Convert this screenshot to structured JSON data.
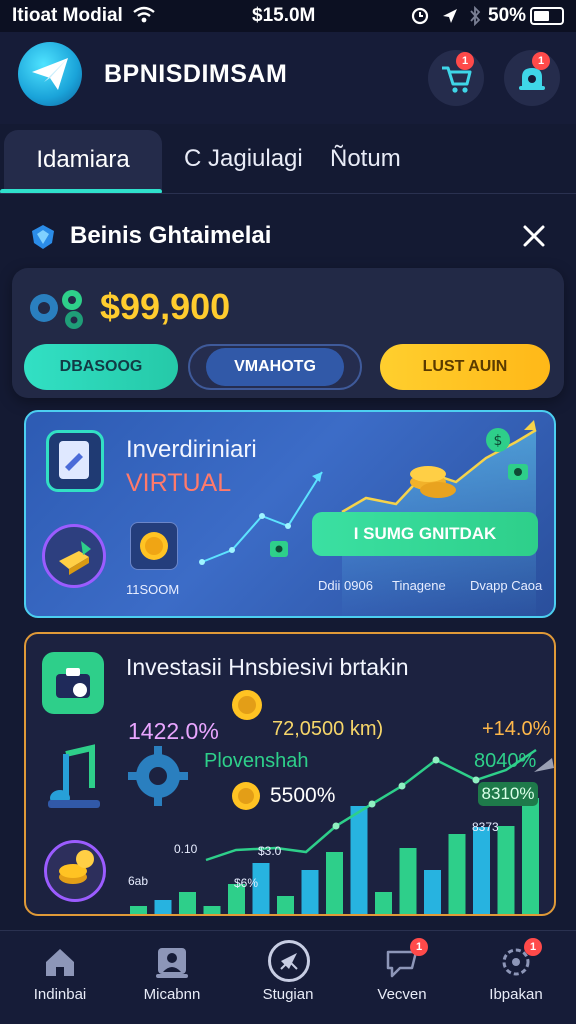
{
  "status_bar": {
    "carrier": "Itioat Modial",
    "center": "$15.0M",
    "battery": "50%"
  },
  "header": {
    "app_title": "BPNISDIMSAM",
    "cart_badge": "1",
    "profile_badge": "1"
  },
  "tabs": [
    {
      "label": "Idamiara",
      "active": true
    },
    {
      "label": "C Jagiulagi",
      "active": false
    },
    {
      "label": "Ñotum",
      "active": false
    }
  ],
  "section": {
    "title": "Beinis Ghtaimelai"
  },
  "balance_card": {
    "amount": "$99,900",
    "buttons": [
      {
        "label": "DBASOOG",
        "color": "#2fd9b8"
      },
      {
        "label": "VMAHOTG",
        "color": "#3159a8"
      },
      {
        "label": "LUST AUIN",
        "color": "#ffc323"
      }
    ]
  },
  "promo_card": {
    "title": "Inverdiriniari",
    "subtitle": "VIRTUAL",
    "cta": "I SUMG GNITDAK",
    "amount_label": "11SOOM",
    "stats": [
      "Ddii 0906",
      "Tinagene",
      "Dvapp Caoa"
    ]
  },
  "investment_card": {
    "title": "Investasii  Hnsbiesivi brtakin",
    "percent_left": "1422.0%",
    "value": "72,0500 km)",
    "percent_right": "+14.0%",
    "label": "Plovenshah",
    "label_percent": "8040%",
    "highlight": "8310%",
    "coin_value": "5500%",
    "bar_labels": [
      "6ab",
      "0.10",
      "$6%",
      "$3.0",
      "8373"
    ],
    "bars": [
      {
        "h": 0.1,
        "c": "#2ecf8a"
      },
      {
        "h": 0.15,
        "c": "#27b3e0"
      },
      {
        "h": 0.22,
        "c": "#2ecf8a"
      },
      {
        "h": 0.1,
        "c": "#2ecf8a"
      },
      {
        "h": 0.28,
        "c": "#2ecf8a"
      },
      {
        "h": 0.46,
        "c": "#27b3e0"
      },
      {
        "h": 0.18,
        "c": "#2ecf8a"
      },
      {
        "h": 0.4,
        "c": "#27b3e0"
      },
      {
        "h": 0.55,
        "c": "#2ecf8a"
      },
      {
        "h": 0.93,
        "c": "#27b3e0"
      },
      {
        "h": 0.22,
        "c": "#2ecf8a"
      },
      {
        "h": 0.58,
        "c": "#2ecf8a"
      },
      {
        "h": 0.4,
        "c": "#27b3e0"
      },
      {
        "h": 0.7,
        "c": "#2ecf8a"
      },
      {
        "h": 0.76,
        "c": "#27b3e0"
      },
      {
        "h": 0.77,
        "c": "#2ecf8a"
      },
      {
        "h": 1.0,
        "c": "#2ecf8a"
      }
    ]
  },
  "bottom_nav": [
    {
      "label": "Indinbai",
      "icon": "home-icon"
    },
    {
      "label": "Micabnn",
      "icon": "profile-icon"
    },
    {
      "label": "Stugian",
      "icon": "compass-icon"
    },
    {
      "label": "Vecven",
      "icon": "message-icon",
      "badge": "1"
    },
    {
      "label": "Ibpakan",
      "icon": "settings-icon",
      "badge": "1"
    }
  ]
}
